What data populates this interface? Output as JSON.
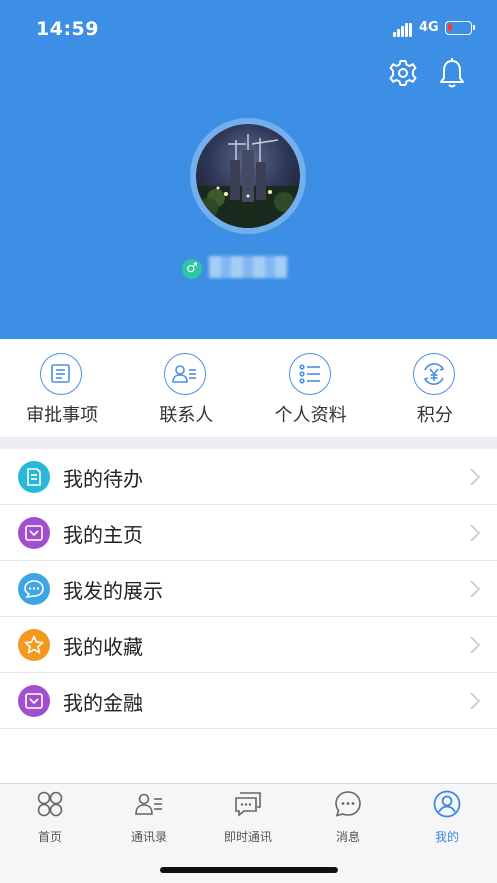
{
  "status_bar": {
    "time": "14:59",
    "network": "4G"
  },
  "profile": {
    "gender_symbol": "♂"
  },
  "quick_actions": [
    {
      "label": "审批事项",
      "icon": "document-list-icon"
    },
    {
      "label": "联系人",
      "icon": "contacts-icon"
    },
    {
      "label": "个人资料",
      "icon": "profile-list-icon"
    },
    {
      "label": "积分",
      "icon": "points-yen-icon"
    }
  ],
  "menu": [
    {
      "label": "我的待办",
      "icon": "todo-icon",
      "color": "#29b8d8"
    },
    {
      "label": "我的主页",
      "icon": "homepage-icon",
      "color": "#a24fcf"
    },
    {
      "label": "我发的展示",
      "icon": "chat-bubble-icon",
      "color": "#3ea6e6"
    },
    {
      "label": "我的收藏",
      "icon": "star-icon",
      "color": "#f39a1e"
    },
    {
      "label": "我的金融",
      "icon": "finance-icon",
      "color": "#a24fcf"
    }
  ],
  "tabs": [
    {
      "label": "首页",
      "icon": "home-grid-icon",
      "active": false
    },
    {
      "label": "通讯录",
      "icon": "address-book-icon",
      "active": false
    },
    {
      "label": "即时通讯",
      "icon": "instant-message-icon",
      "active": false
    },
    {
      "label": "消息",
      "icon": "message-icon",
      "active": false
    },
    {
      "label": "我的",
      "icon": "me-icon",
      "active": true
    }
  ],
  "colors": {
    "header": "#3d8fe6",
    "accent": "#3b88e3",
    "tab_inactive": "#555555"
  }
}
